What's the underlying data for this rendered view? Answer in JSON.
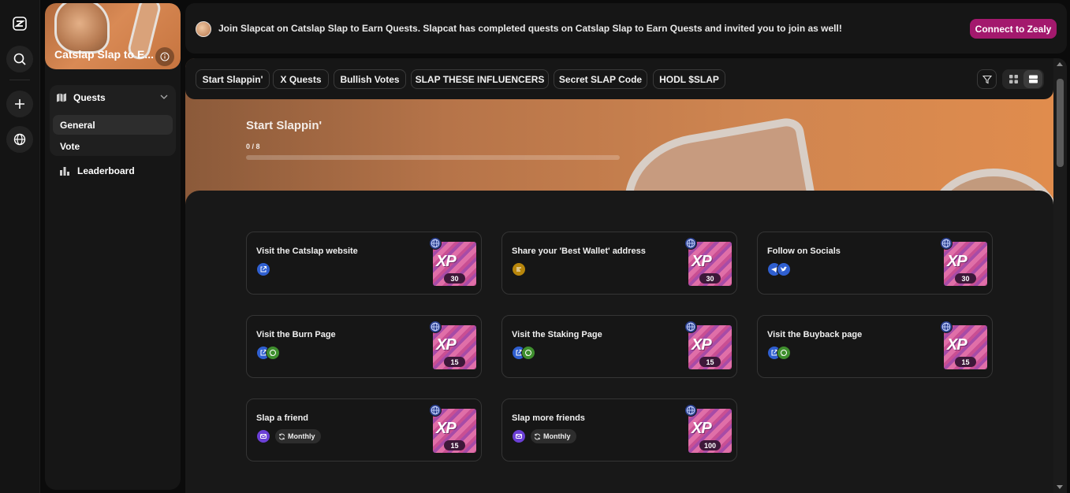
{
  "community": {
    "name": "Catslap Slap to E..."
  },
  "sidebar": {
    "quests_label": "Quests",
    "items": [
      {
        "label": "General",
        "active": true
      },
      {
        "label": "Vote",
        "active": false
      }
    ],
    "leaderboard_label": "Leaderboard"
  },
  "announcement": {
    "text": "Join Slapcat on Catslap Slap to Earn Quests. Slapcat has completed quests on Catslap Slap to Earn Quests and invited you to join as well!",
    "button": "Connect to Zealy"
  },
  "tabs": [
    "Start Slappin'",
    "X Quests",
    "Bullish Votes",
    "SLAP THESE INFLUENCERS",
    "Secret SLAP Code",
    "HODL $SLAP"
  ],
  "category": {
    "title": "Start Slappin'",
    "progress_text": "0 / 8",
    "progress_fraction": 0
  },
  "quests": [
    {
      "title": "Visit the Catslap website",
      "xp": "30",
      "badges": [
        "link-icon"
      ],
      "recurrence": ""
    },
    {
      "title": "Share your 'Best Wallet' address",
      "xp": "30",
      "badges": [
        "text-icon"
      ],
      "recurrence": ""
    },
    {
      "title": "Follow on Socials",
      "xp": "30",
      "badges": [
        "telegram-icon",
        "twitter-icon"
      ],
      "recurrence": ""
    },
    {
      "title": "Visit the Burn Page",
      "xp": "15",
      "badges": [
        "link-icon",
        "chat-icon"
      ],
      "recurrence": ""
    },
    {
      "title": "Visit the Staking Page",
      "xp": "15",
      "badges": [
        "link-icon",
        "chat-icon"
      ],
      "recurrence": ""
    },
    {
      "title": "Visit the Buyback page",
      "xp": "15",
      "badges": [
        "link-icon",
        "chat-icon"
      ],
      "recurrence": ""
    },
    {
      "title": "Slap a friend",
      "xp": "15",
      "badges": [
        "invite-icon"
      ],
      "recurrence": "Monthly"
    },
    {
      "title": "Slap more friends",
      "xp": "100",
      "badges": [
        "invite-icon"
      ],
      "recurrence": "Monthly"
    }
  ],
  "xp_label": "XP",
  "colors": {
    "accent": "#a3196d",
    "badge_blue": "#2f5fd0",
    "badge_green": "#3f8f2e",
    "badge_gold": "#b8860b",
    "badge_purple": "#6b3fd6"
  }
}
